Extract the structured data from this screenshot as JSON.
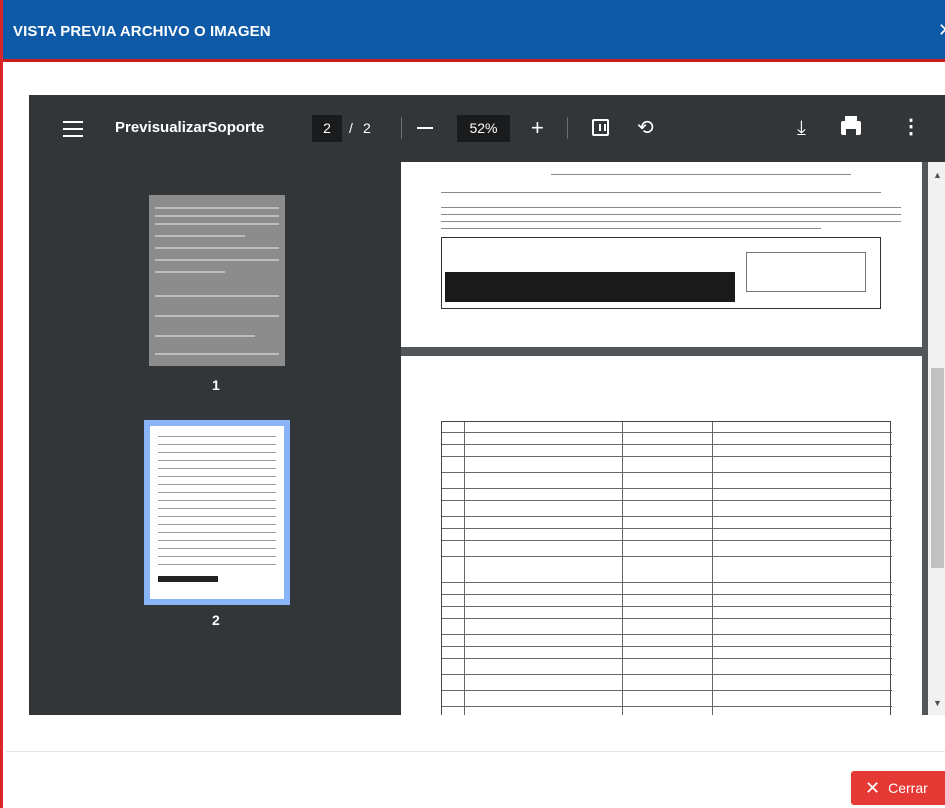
{
  "modal": {
    "title": "VISTA PREVIA ARCHIVO O IMAGEN",
    "close_label": "Cerrar"
  },
  "viewer": {
    "document_title": "PrevisualizarSoporte",
    "current_page": "2",
    "page_separator": "/",
    "total_pages": "2",
    "zoom": "52%"
  },
  "thumbnails": [
    {
      "label": "1",
      "selected": false
    },
    {
      "label": "2",
      "selected": true
    }
  ],
  "icons": {
    "menu": "hamburger-icon",
    "zoom_out": "minus-icon",
    "zoom_in": "plus-icon",
    "fit": "fit-page-icon",
    "rotate": "rotate-icon",
    "download": "download-icon",
    "print": "print-icon",
    "more": "more-vert-icon"
  },
  "colors": {
    "header_bg": "#0e5aa7",
    "accent_red": "#e53935",
    "toolbar_bg": "#323639",
    "viewer_bg": "#525659",
    "thumb_selected": "#8ab4f8"
  }
}
